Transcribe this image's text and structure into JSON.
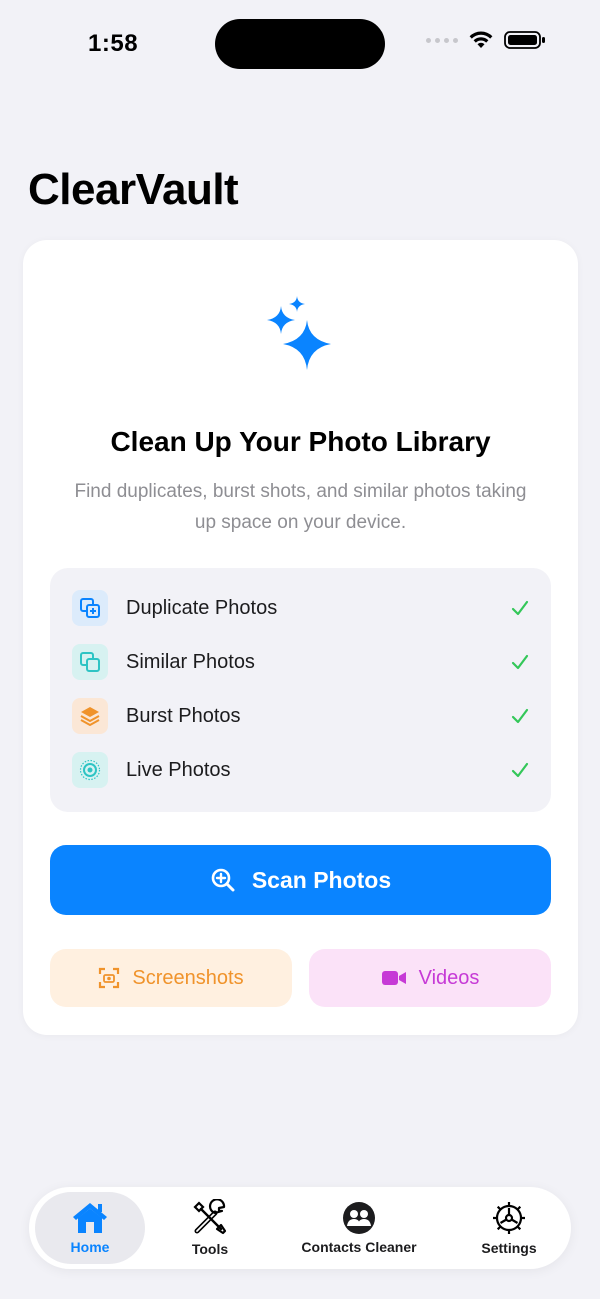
{
  "status": {
    "time": "1:58"
  },
  "app_title": "ClearVault",
  "card": {
    "heading": "Clean Up Your Photo Library",
    "subtitle": "Find duplicates, burst shots, and similar photos taking up space on your device.",
    "features": [
      {
        "label": "Duplicate Photos",
        "icon": "duplicate-icon",
        "color": "#0a84ff",
        "checked": true
      },
      {
        "label": "Similar Photos",
        "icon": "similar-icon",
        "color": "#2ec4c4",
        "checked": true
      },
      {
        "label": "Burst Photos",
        "icon": "stack-icon",
        "color": "#f0932b",
        "checked": true
      },
      {
        "label": "Live Photos",
        "icon": "live-photo-icon",
        "color": "#2ec4c4",
        "checked": true
      }
    ],
    "scan_label": "Scan Photos",
    "screenshots_label": "Screenshots",
    "videos_label": "Videos"
  },
  "tabs": [
    {
      "label": "Home",
      "icon": "house-icon",
      "active": true
    },
    {
      "label": "Tools",
      "icon": "tools-icon",
      "active": false
    },
    {
      "label": "Contacts Cleaner",
      "icon": "people-icon",
      "active": false
    },
    {
      "label": "Settings",
      "icon": "gear-icon",
      "active": false
    }
  ],
  "colors": {
    "accent": "#0a84ff",
    "check": "#34c759",
    "screenshots": "#f0932b",
    "videos": "#c63ad6",
    "background": "#f2f2f7"
  }
}
